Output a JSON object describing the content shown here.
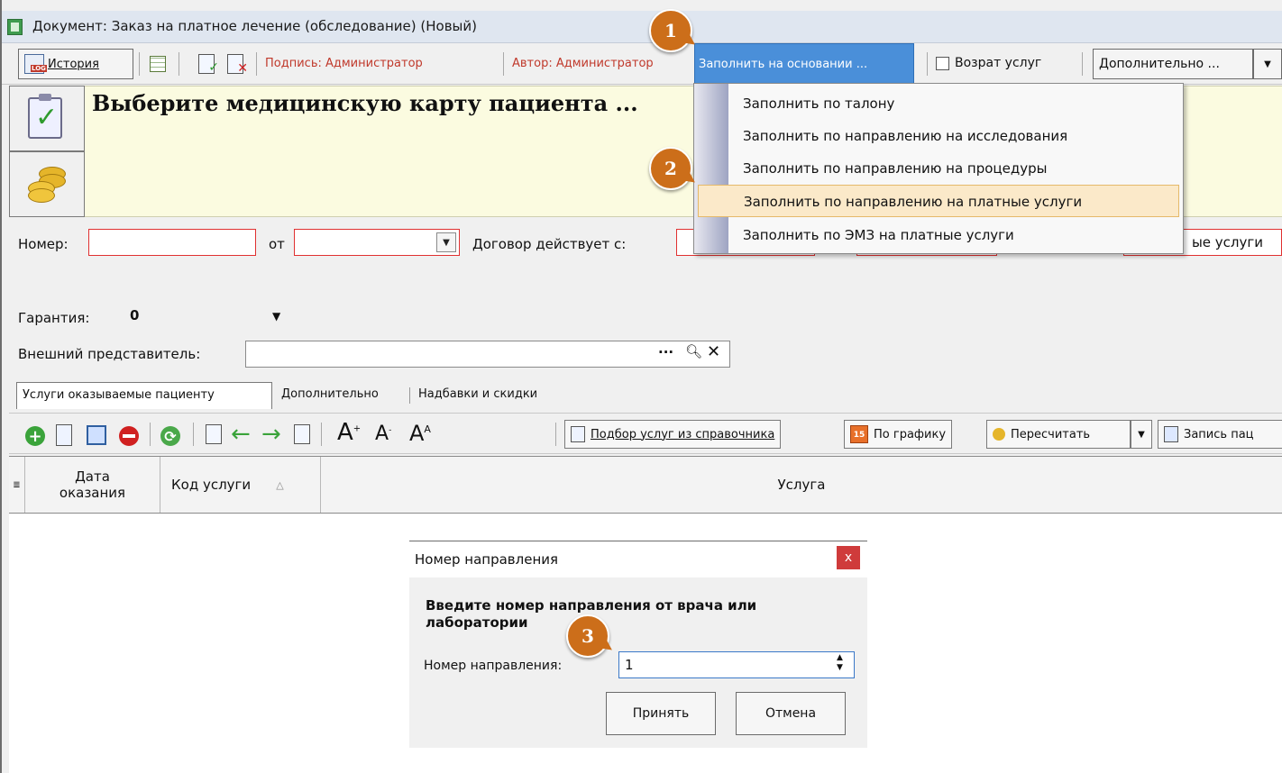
{
  "window": {
    "title": "Документ: Заказ на платное лечение (обследование) (Новый)"
  },
  "toolbar": {
    "history_label": "История",
    "signature_label": "Подпись: Администратор",
    "author_label": "Автор: Администратор",
    "fill_based_on_label": "Заполнить на основании ...",
    "return_services_label": "Возрат услуг",
    "additional_label": "Дополнительно ..."
  },
  "header": {
    "title": "Выберите медицинскую карту пациента ..."
  },
  "fill_menu": {
    "items": [
      {
        "label": "Заполнить по талону"
      },
      {
        "label": "Заполнить по направлению на исследования"
      },
      {
        "label": "Заполнить по направлению на процедуры"
      },
      {
        "label": "Заполнить по направлению на платные услуги"
      },
      {
        "label": "Заполнить по ЭМЗ на платные услуги"
      }
    ]
  },
  "form": {
    "number_label": "Номер:",
    "number_value": "",
    "from_label": "от",
    "from_value": "",
    "contract_label": "Договор действует с:",
    "partial_right_text": "ые услуги",
    "guarantee_label": "Гарантия:",
    "guarantee_value": "0",
    "representative_label": "Внешний представитель:",
    "representative_value": ""
  },
  "tabs": [
    {
      "label": "Услуги оказываемые пациенту",
      "active": true
    },
    {
      "label": "Дополнительно",
      "active": false
    },
    {
      "label": "Надбавки и скидки",
      "active": false
    }
  ],
  "grid_toolbar": {
    "pick_services_label": "Подбор услуг из справочника",
    "schedule_label": "По графику",
    "schedule_icon_number": "15",
    "recalc_label": "Пересчитать",
    "record_label": "Запись пац"
  },
  "grid": {
    "columns": [
      "Дата оказания",
      "Код услуги",
      "Услуга"
    ]
  },
  "dialog": {
    "title": "Номер направления",
    "prompt": "Введите номер направления от врача или лаборатории",
    "field_label": "Номер направления:",
    "field_value": "1",
    "accept_label": "Принять",
    "cancel_label": "Отмена"
  },
  "callouts": [
    "1",
    "2",
    "3"
  ],
  "colors": {
    "accent": "#4a8fd9",
    "callout": "#cc6e1a",
    "required_border": "#e03030",
    "menu_hover": "#fbe9c9",
    "header_bg": "#fbfbe0",
    "link_red": "#c0392b",
    "link_blue": "#1f3fa0"
  }
}
